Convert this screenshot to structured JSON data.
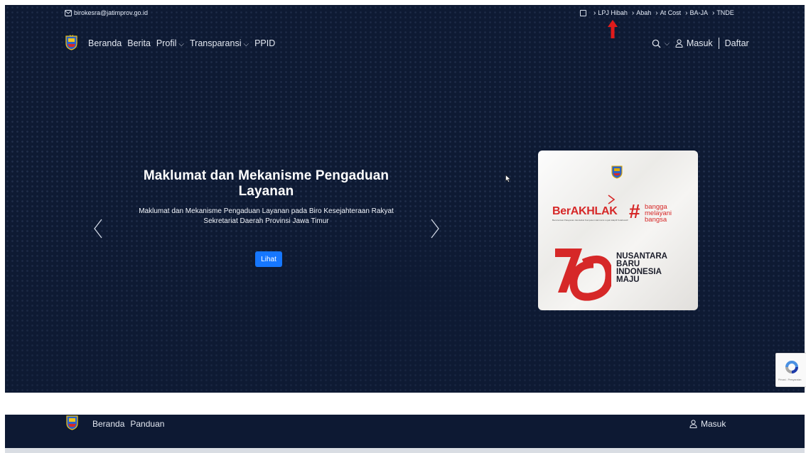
{
  "topbar": {
    "email": "birokesra@jatimprov.go.id",
    "links": [
      "LPJ Hibah",
      "Abah",
      "At Cost",
      "BA-JA",
      "TNDE"
    ]
  },
  "nav": {
    "items": [
      {
        "label": "Beranda",
        "dropdown": false
      },
      {
        "label": "Berita",
        "dropdown": false
      },
      {
        "label": "Profil",
        "dropdown": true
      },
      {
        "label": "Transparansi",
        "dropdown": true
      },
      {
        "label": "PPID",
        "dropdown": false
      }
    ],
    "login": "Masuk",
    "register": "Daftar"
  },
  "hero": {
    "title": "Maklumat dan Mekanisme Pengaduan Layanan",
    "subtitle": "Maklumat dan Mekanisme Pengaduan Layanan pada Biro Kesejahteraan Rakyat Sekretariat Daerah Provinsi Jawa Timur",
    "button": "Lihat"
  },
  "card": {
    "berakhlak": "BerAKHLAK",
    "berakhlak_tagline": "Berorientasi Pelayanan Akuntabel Kompeten Harmonis Loyal Adaptif Kolaboratif",
    "hashtag": "#",
    "slogan": [
      "bangga",
      "melayani",
      "bangsa"
    ],
    "anniversary": [
      "NUSANTARA",
      "BARU",
      "INDONESIA",
      "MAJU"
    ]
  },
  "recaptcha": {
    "text": "Privasi - Persyaratan"
  },
  "second_nav": {
    "items": [
      "Beranda",
      "Panduan"
    ],
    "login": "Masuk"
  },
  "colors": {
    "background": "#0e1a33",
    "accent": "#1677ff",
    "brand_red": "#d62828",
    "annotation_arrow": "#e01b1b"
  }
}
